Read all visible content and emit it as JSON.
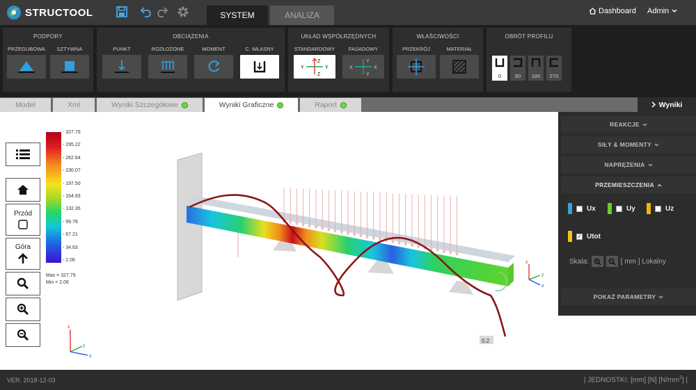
{
  "app": {
    "name": "STRUCTOOL"
  },
  "header": {
    "tabs": [
      {
        "label": "SYSTEM"
      },
      {
        "label": "ANALIZA"
      }
    ],
    "dashboard_label": "Dashboard",
    "user_label": "Admin"
  },
  "toolbar": {
    "podpory": {
      "title": "PODPORY",
      "items": [
        {
          "label": "PRZEGUBOWA"
        },
        {
          "label": "SZTYWNA"
        }
      ]
    },
    "obciazenia": {
      "title": "OBCIĄŻENIA",
      "items": [
        {
          "label": "PUNKT"
        },
        {
          "label": "ROZŁOŻONE"
        },
        {
          "label": "MOMENT"
        },
        {
          "label": "C. WŁASNY"
        }
      ]
    },
    "uklad": {
      "title": "UKŁAD WSPÓŁRZĘDNYCH",
      "items": [
        {
          "label": "STANDARDOWY"
        },
        {
          "label": "FASADOWY"
        }
      ]
    },
    "wlasciwosci": {
      "title": "WŁAŚCIWOŚCI",
      "items": [
        {
          "label": "PRZEKRÓJ"
        },
        {
          "label": "MATERIAŁ"
        }
      ]
    },
    "obrot": {
      "title": "OBRÓT PROFILU",
      "items": [
        {
          "value": "0"
        },
        {
          "value": "90"
        },
        {
          "value": "180"
        },
        {
          "value": "270"
        }
      ]
    }
  },
  "view_tabs": [
    {
      "label": "Model"
    },
    {
      "label": "Xml"
    },
    {
      "label": "Wyniki Szczegółowe"
    },
    {
      "label": "Wyniki Graficzne"
    },
    {
      "label": "Raport"
    }
  ],
  "results_tab": {
    "label": "Wyniki"
  },
  "view_controls": {
    "front_label": "Przód",
    "top_label": "Góra"
  },
  "legend": {
    "ticks": [
      "327.79",
      "295.22",
      "262.64",
      "230.07",
      "197.50",
      "164.93",
      "132.35",
      "99.78",
      "67.21",
      "34.63",
      "2.06"
    ],
    "max_text": "Max = 327.79",
    "min_text": "Min = 2.06"
  },
  "axes": {
    "x": "x",
    "y": "y",
    "z": "z"
  },
  "scale_label": "0.2",
  "results_panel": {
    "sections": [
      {
        "label": "REAKCJE"
      },
      {
        "label": "SIŁY & MOMENTY"
      },
      {
        "label": "NAPRĘŻENIA"
      },
      {
        "label": "PRZEMIESZCZENIA"
      }
    ],
    "components": [
      {
        "label": "Ux",
        "color": "#3aa0d8",
        "checked": false
      },
      {
        "label": "Uy",
        "color": "#6ccc2e",
        "checked": false
      },
      {
        "label": "Uz",
        "color": "#f2b20e",
        "checked": false
      },
      {
        "label": "Utot",
        "color": "#f2c20e",
        "checked": true
      }
    ],
    "skala": {
      "label": "Skala:",
      "units": "[ mm ] Lokalny"
    },
    "params_label": "POKAŻ PARAMETRY"
  },
  "footer": {
    "version": "VER. 2018-12-03",
    "units_prefix": "| JEDNOSTKI: [mm] [N] [N/mm",
    "units_sup": "2",
    "units_suffix": "] |"
  }
}
